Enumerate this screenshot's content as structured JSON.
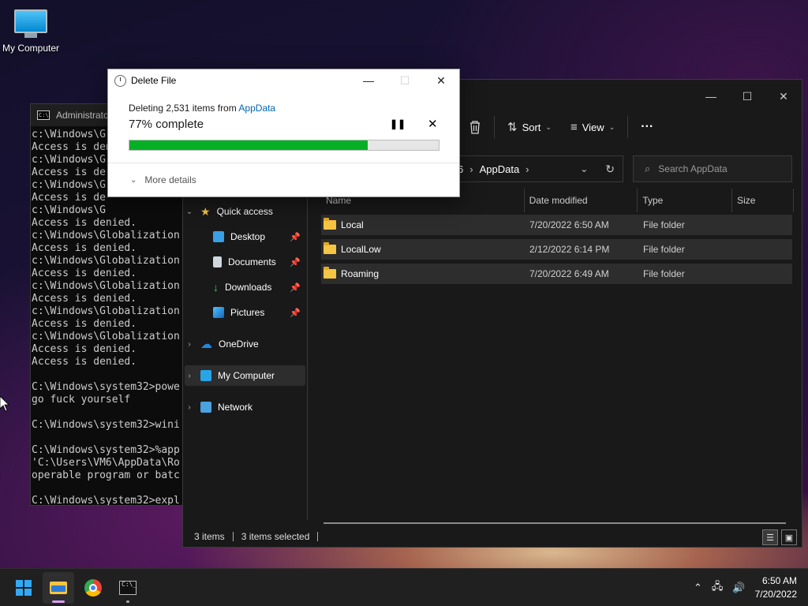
{
  "desktop": {
    "icon_label": "My Computer"
  },
  "cmd": {
    "title": "Administrato",
    "lines": [
      "c:\\Windows\\G",
      "Access is deni",
      "c:\\Windows\\G",
      "Access is de",
      "c:\\Windows\\G",
      "Access is de",
      "c:\\Windows\\G",
      "Access is denied.",
      "c:\\Windows\\Globalization",
      "Access is denied.",
      "c:\\Windows\\Globalization",
      "Access is denied.",
      "c:\\Windows\\Globalization",
      "Access is denied.",
      "c:\\Windows\\Globalization",
      "Access is denied.",
      "c:\\Windows\\Globalization",
      "Access is denied.",
      "Access is denied.",
      "",
      "C:\\Windows\\system32>powe",
      "go fuck yourself",
      "",
      "C:\\Windows\\system32>wini",
      "",
      "C:\\Windows\\system32>%app",
      "'C:\\Users\\VM6\\AppData\\Ro",
      "operable program or batc",
      "",
      "C:\\Windows\\system32>expl",
      "",
      "C:\\Windows\\system32>"
    ]
  },
  "dialog": {
    "title": "Delete File",
    "deleting_prefix": "Deleting 2,531 items from ",
    "deleting_link": "AppData",
    "percent_text": "77% complete",
    "progress": 0.77,
    "more_details": "More details",
    "progress_color": "#06b025"
  },
  "explorer": {
    "toolbar": {
      "sort": "Sort",
      "view": "View",
      "more": "···"
    },
    "address": {
      "prefix": "6",
      "current": "AppData"
    },
    "search_placeholder": "Search AppData",
    "columns": {
      "name": "Name",
      "date": "Date modified",
      "type": "Type",
      "size": "Size"
    },
    "rows": [
      {
        "name": "Local",
        "date": "7/20/2022 6:50 AM",
        "type": "File folder"
      },
      {
        "name": "LocalLow",
        "date": "2/12/2022 6:14 PM",
        "type": "File folder"
      },
      {
        "name": "Roaming",
        "date": "7/20/2022 6:49 AM",
        "type": "File folder"
      }
    ],
    "nav": {
      "quick_access": "Quick access",
      "desktop": "Desktop",
      "documents": "Documents",
      "downloads": "Downloads",
      "pictures": "Pictures",
      "onedrive": "OneDrive",
      "my_computer": "My Computer",
      "network": "Network"
    },
    "status": {
      "items": "3 items",
      "selected": "3 items selected"
    }
  },
  "taskbar": {
    "time": "6:50 AM",
    "date": "7/20/2022",
    "accent": "#d89cf6"
  }
}
